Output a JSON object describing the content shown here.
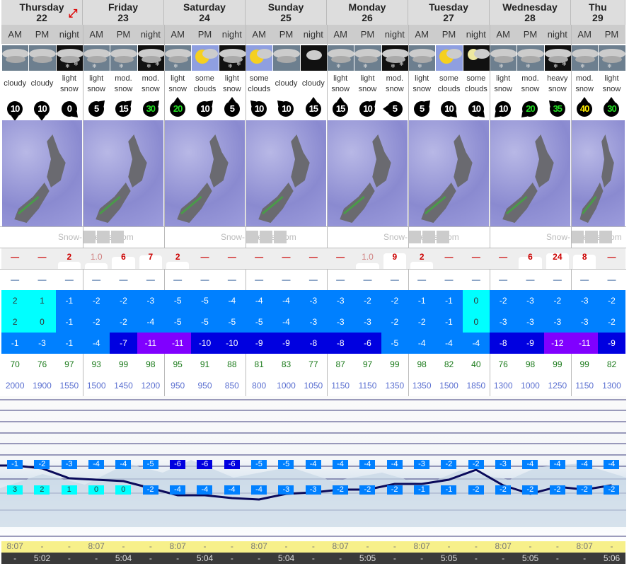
{
  "days": [
    {
      "name": "Thursday",
      "date": "22",
      "periods": [
        "AM",
        "PM",
        "night"
      ]
    },
    {
      "name": "Friday",
      "date": "23",
      "periods": [
        "AM",
        "PM",
        "night"
      ]
    },
    {
      "name": "Saturday",
      "date": "24",
      "periods": [
        "AM",
        "PM",
        "night"
      ]
    },
    {
      "name": "Sunday",
      "date": "25",
      "periods": [
        "AM",
        "PM",
        "night"
      ]
    },
    {
      "name": "Monday",
      "date": "26",
      "periods": [
        "AM",
        "PM",
        "night"
      ]
    },
    {
      "name": "Tuesday",
      "date": "27",
      "periods": [
        "AM",
        "PM",
        "night"
      ]
    },
    {
      "name": "Wednesday",
      "date": "28",
      "periods": [
        "AM",
        "PM",
        "night"
      ]
    },
    {
      "name": "Thu",
      "date": "29",
      "periods": [
        "AM",
        "PM"
      ]
    }
  ],
  "expand_icon": "expand-arrows-icon",
  "icons": [
    "cloudy",
    "cloudy",
    "snow-night",
    "snow",
    "snow",
    "snow-night",
    "snow",
    "sun-cloud",
    "snow-night",
    "sun-cloud",
    "cloudy",
    "cloud-night",
    "snow",
    "snow",
    "snow-night",
    "snow",
    "sun-cloud",
    "moon-cloud",
    "snow",
    "snow",
    "snow-night-heavy",
    "snow",
    "snow"
  ],
  "descriptions": [
    [
      "cloudy"
    ],
    [
      "cloudy"
    ],
    [
      "light",
      "snow"
    ],
    [
      "light",
      "snow"
    ],
    [
      "mod.",
      "snow"
    ],
    [
      "mod.",
      "snow"
    ],
    [
      "light",
      "snow"
    ],
    [
      "some",
      "clouds"
    ],
    [
      "light",
      "snow"
    ],
    [
      "some",
      "clouds"
    ],
    [
      "cloudy"
    ],
    [
      "cloudy"
    ],
    [
      "light",
      "snow"
    ],
    [
      "light",
      "snow"
    ],
    [
      "mod.",
      "snow"
    ],
    [
      "light",
      "snow"
    ],
    [
      "some",
      "clouds"
    ],
    [
      "some",
      "clouds"
    ],
    [
      "light",
      "snow"
    ],
    [
      "mod.",
      "snow"
    ],
    [
      "heavy",
      "snow"
    ],
    [
      "mod.",
      "snow"
    ],
    [
      "light",
      "snow"
    ]
  ],
  "wind_speed": [
    "10",
    "10",
    "0",
    "5",
    "15",
    "30",
    "20",
    "10",
    "5",
    "10",
    "10",
    "15",
    "15",
    "10",
    "5",
    "5",
    "10",
    "10",
    "10",
    "20",
    "35",
    "40",
    "30"
  ],
  "wind_direction": [
    "S",
    "S",
    "SE",
    "NE",
    "NE",
    "NE",
    "N",
    "NE",
    "N",
    "NW",
    "NW",
    "N",
    "N",
    "NE",
    "W",
    "NE",
    "SE",
    "SE",
    "SW",
    "SW",
    "NW",
    "N",
    "N"
  ],
  "colors": {
    "wind_normal": "#ffffff",
    "wind_strong": "#22dd22",
    "wind_very_strong": "#ffee00",
    "temp_above_zero": "#00ffff",
    "temp_cold": "#0080ff",
    "temp_colder": "#0000e0",
    "temp_coldest": "#8000ff"
  },
  "logo_text": "Snow-Forecast.com",
  "snow": [
    "—",
    "—",
    "2",
    "1.0",
    "6",
    "7",
    "2",
    "—",
    "—",
    "—",
    "—",
    "—",
    "—",
    "1.0",
    "9",
    "2",
    "—",
    "—",
    "—",
    "6",
    "24",
    "8",
    "—"
  ],
  "rain": [
    "—",
    "—",
    "—",
    "—",
    "—",
    "—",
    "—",
    "—",
    "—",
    "—",
    "—",
    "—",
    "—",
    "—",
    "—",
    "—",
    "—",
    "—",
    "—",
    "—",
    "—",
    "—",
    "—"
  ],
  "temp_max": [
    "2",
    "1",
    "-1",
    "-2",
    "-2",
    "-3",
    "-5",
    "-5",
    "-4",
    "-4",
    "-4",
    "-3",
    "-3",
    "-2",
    "-2",
    "-1",
    "-1",
    "0",
    "-2",
    "-3",
    "-2",
    "-3",
    "-2"
  ],
  "temp_min": [
    "2",
    "0",
    "-1",
    "-2",
    "-2",
    "-4",
    "-5",
    "-5",
    "-5",
    "-5",
    "-4",
    "-3",
    "-3",
    "-3",
    "-2",
    "-2",
    "-1",
    "0",
    "-3",
    "-3",
    "-3",
    "-3",
    "-2"
  ],
  "wind_chill": [
    "-1",
    "-3",
    "-1",
    "-4",
    "-7",
    "-11",
    "-11",
    "-10",
    "-10",
    "-9",
    "-9",
    "-8",
    "-8",
    "-6",
    "-5",
    "-4",
    "-4",
    "-4",
    "-8",
    "-9",
    "-12",
    "-11",
    "-9"
  ],
  "humidity": [
    "70",
    "76",
    "97",
    "93",
    "99",
    "98",
    "95",
    "91",
    "88",
    "81",
    "83",
    "77",
    "87",
    "97",
    "99",
    "98",
    "82",
    "40",
    "76",
    "98",
    "99",
    "99",
    "82"
  ],
  "freezing_level": [
    "2000",
    "1900",
    "1550",
    "1500",
    "1450",
    "1200",
    "950",
    "950",
    "850",
    "800",
    "1000",
    "1050",
    "1150",
    "1150",
    "1350",
    "1350",
    "1500",
    "1850",
    "1300",
    "1000",
    "1250",
    "1150",
    "1300"
  ],
  "chart_top_temps": [
    "-1",
    "-2",
    "-3",
    "-4",
    "-4",
    "-5",
    "-6",
    "-6",
    "-6",
    "-5",
    "-5",
    "-4",
    "-4",
    "-4",
    "-4",
    "-3",
    "-2",
    "-2",
    "-3",
    "-4",
    "-4",
    "-4",
    "-4"
  ],
  "chart_bottom_temps": [
    "3",
    "2",
    "1",
    "0",
    "0",
    "-2",
    "-4",
    "-4",
    "-4",
    "-4",
    "-3",
    "-3",
    "-2",
    "-2",
    "-2",
    "-1",
    "-1",
    "-2",
    "-2",
    "-2",
    "-2",
    "-2",
    "-2"
  ],
  "sunrise": [
    "8:07",
    "-",
    "-",
    "8:07",
    "-",
    "-",
    "8:07",
    "-",
    "-",
    "8:07",
    "-",
    "-",
    "8:07",
    "-",
    "-",
    "8:07",
    "-",
    "-",
    "8:07",
    "-",
    "-",
    "8:07",
    "-"
  ],
  "sunset": [
    "-",
    "5:02",
    "-",
    "-",
    "5:04",
    "-",
    "-",
    "5:04",
    "-",
    "-",
    "5:04",
    "-",
    "-",
    "5:05",
    "-",
    "-",
    "5:05",
    "-",
    "-",
    "5:05",
    "-",
    "-",
    "5:06"
  ]
}
